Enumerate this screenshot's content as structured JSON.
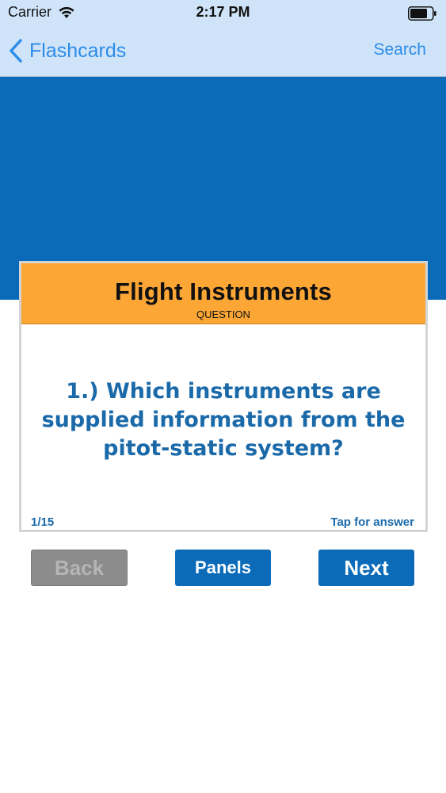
{
  "status_bar": {
    "carrier": "Carrier",
    "time": "2:17 PM",
    "wifi_icon": "wifi-icon",
    "battery_icon": "battery-icon"
  },
  "nav": {
    "back_label": "Flashcards",
    "back_icon": "chevron-left-icon",
    "search_label": "Search"
  },
  "card": {
    "title": "Flight Instruments",
    "subtitle": "QUESTION",
    "question": "1.) Which instruments are supplied information from the pitot-static system?",
    "counter": "1/15",
    "hint": "Tap for answer"
  },
  "buttons": {
    "back": "Back",
    "panels": "Panels",
    "next": "Next"
  },
  "colors": {
    "nav_background": "#cfe4f8",
    "accent": "#2d8ce8",
    "hero_blue": "#0b6bb9",
    "card_header": "#fba635",
    "question_text": "#1a69a9",
    "disabled_button": "#8c8c8c"
  }
}
